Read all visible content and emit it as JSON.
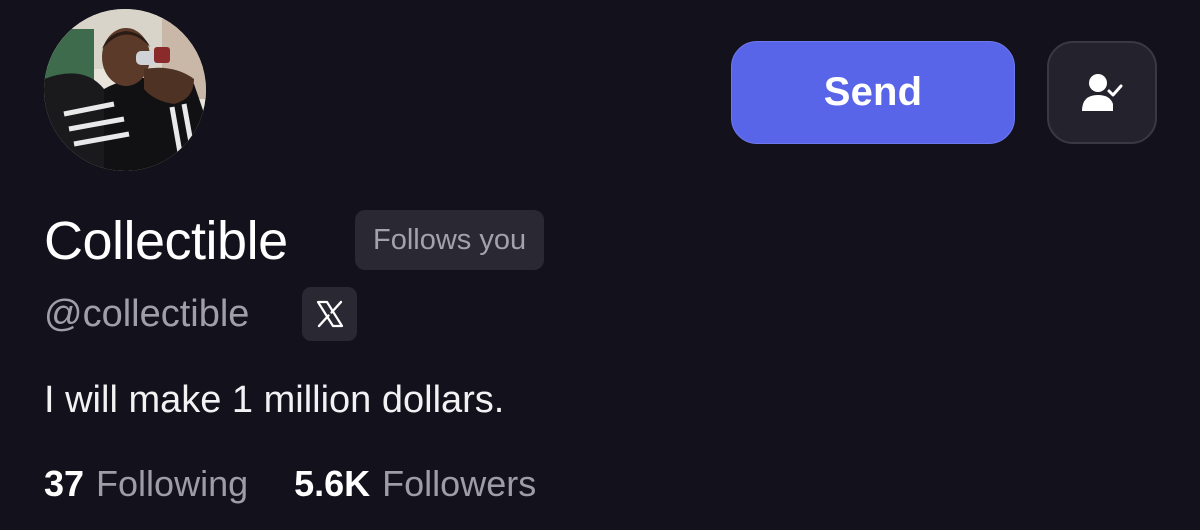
{
  "profile": {
    "avatar_alt": "Profile picture",
    "display_name": "Collectible",
    "follows_you_label": "Follows you",
    "handle": "@collectible",
    "x_badge_icon": "x-logo-icon",
    "bio": "I will make 1 million dollars."
  },
  "actions": {
    "send_label": "Send",
    "send_color": "#5865e8",
    "follow_icon": "user-check-icon"
  },
  "stats": {
    "following_count": "37",
    "following_label": "Following",
    "followers_count": "5.6K",
    "followers_label": "Followers"
  },
  "colors": {
    "background": "#13111b",
    "muted_text": "#a09ea8",
    "badge_bg": "#2a2832"
  }
}
